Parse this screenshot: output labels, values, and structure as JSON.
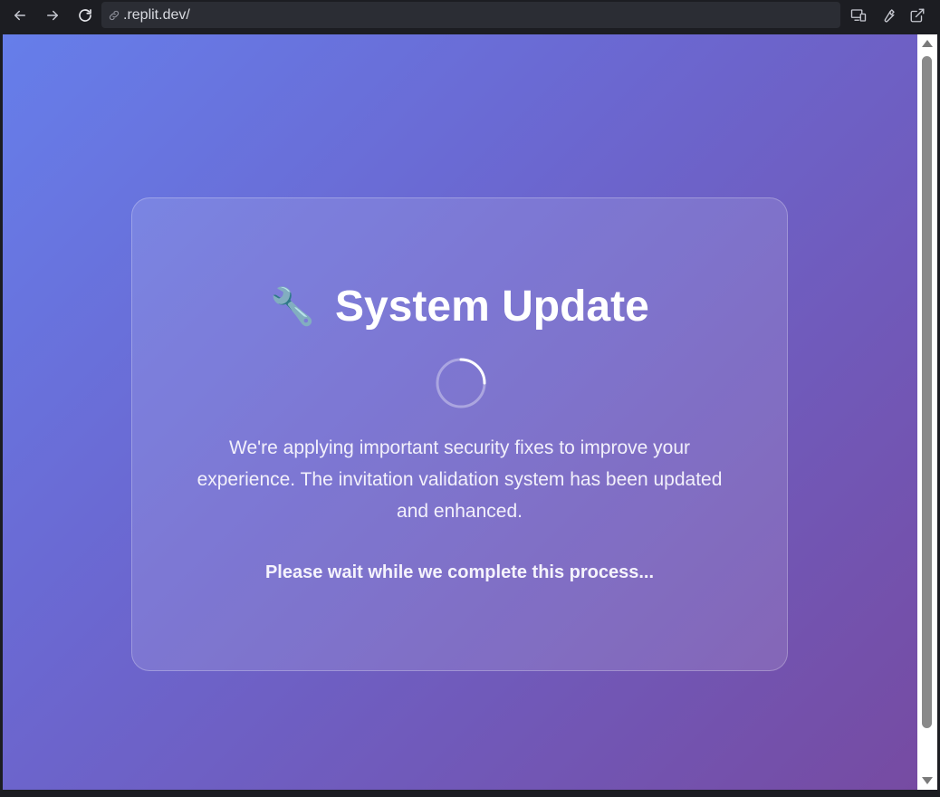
{
  "browser": {
    "url": ".replit.dev/",
    "icons": {
      "back": "arrow-left-icon",
      "forward": "arrow-right-icon",
      "reload": "reload-icon",
      "link": "link-icon",
      "devices": "devices-icon",
      "devtools": "wrench-icon",
      "open_external": "external-link-icon"
    }
  },
  "page": {
    "title_emoji": "🔧",
    "title": "System Update",
    "message": "We're applying important security fixes to improve your experience. The invitation validation system has been updated and enhanced.",
    "wait_text": "Please wait while we complete this process...",
    "colors": {
      "gradient_start": "#667eea",
      "gradient_end": "#764ba2",
      "text": "#ffffff"
    }
  }
}
